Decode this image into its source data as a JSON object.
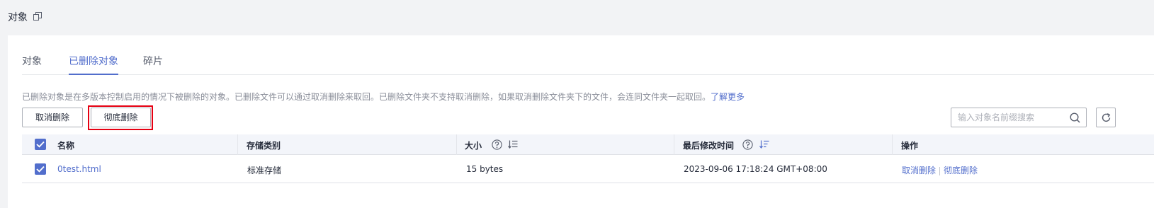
{
  "header": {
    "title": "对象",
    "copy_icon": "copy-icon"
  },
  "tabs": [
    {
      "label": "对象",
      "active": false
    },
    {
      "label": "已删除对象",
      "active": true
    },
    {
      "label": "碎片",
      "active": false
    }
  ],
  "notice": {
    "text": "已删除对象是在多版本控制启用的情况下被删除的对象。已删除文件可以通过取消删除来取回。已删除文件夹不支持取消删除，如果取消删除文件夹下的文件，会连同文件夹一起取回。",
    "link": "了解更多"
  },
  "toolbar": {
    "cancel_delete_label": "取消删除",
    "permanent_delete_label": "彻底删除",
    "search_placeholder": "输入对象名前缀搜索",
    "search_value": ""
  },
  "table": {
    "columns": [
      "名称",
      "存储类别",
      "大小",
      "最后修改时间",
      "操作"
    ],
    "rows": [
      {
        "selected": true,
        "name": "0test.html",
        "storage_class": "标准存储",
        "size": "15 bytes",
        "modified": "2023-09-06 17:18:24 GMT+08:00",
        "actions": [
          "取消删除",
          "彻底删除"
        ]
      }
    ]
  },
  "colors": {
    "accent": "#526ecc",
    "highlight": "#e60012"
  }
}
